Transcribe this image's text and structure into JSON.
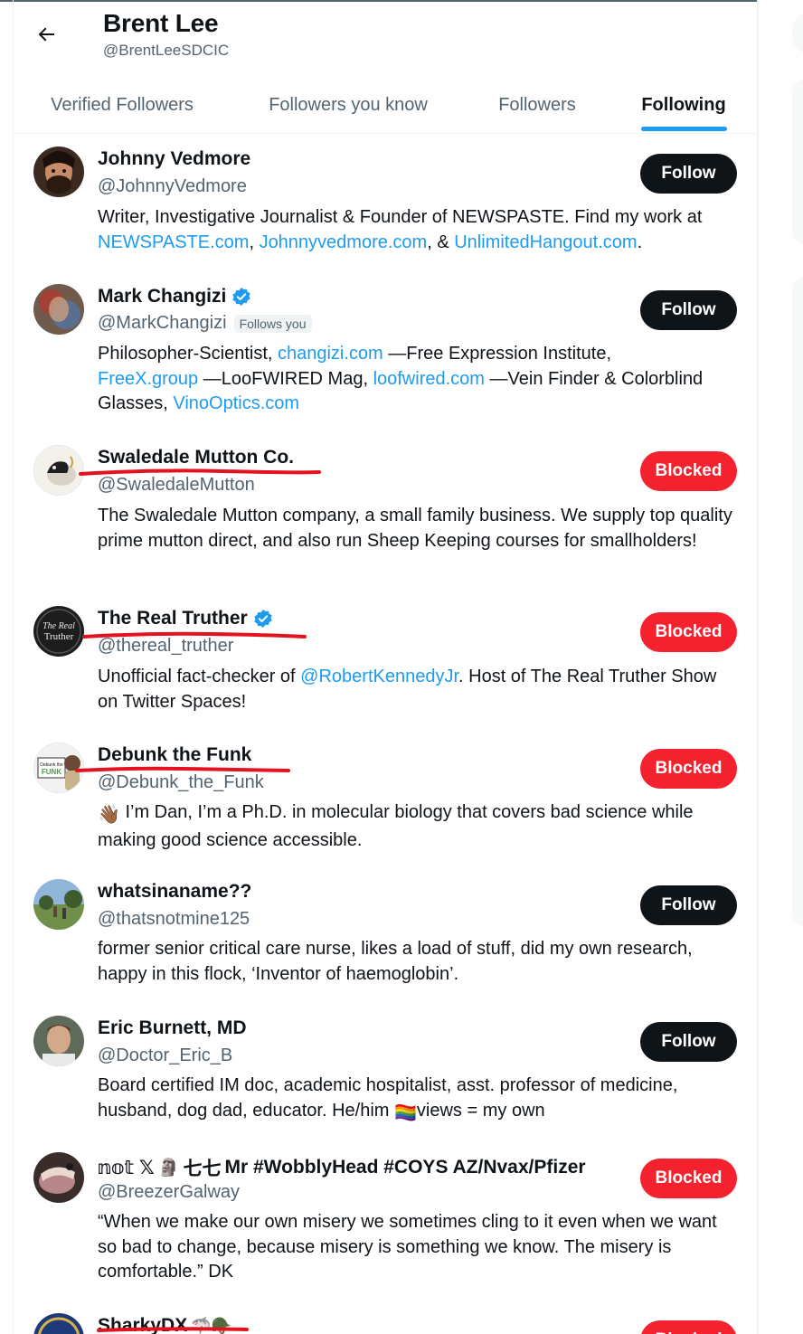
{
  "profile": {
    "name": "Brent Lee",
    "handle": "@BrentLeeSDCIC"
  },
  "tabs": [
    {
      "label": "Verified Followers"
    },
    {
      "label": "Followers you know"
    },
    {
      "label": "Followers"
    },
    {
      "label": "Following"
    }
  ],
  "active_tab": "Following",
  "accent_color": "#1d9bf0",
  "block_color": "#f4212e",
  "users": [
    {
      "name": "Johnny Vedmore",
      "handle": "@JohnnyVedmore",
      "button": "Follow",
      "bio_text": "Writer, Investigative Journalist & Founder of NEWSPASTE. Find my work at ",
      "bio_link1": "NEWSPASTE.com",
      "bio_sep1": ", ",
      "bio_link2": "Johnnyvedmore.com",
      "bio_sep2": ", & ",
      "bio_link3": "UnlimitedHangout.com",
      "bio_end": "."
    },
    {
      "name": "Mark Changizi",
      "handle": "@MarkChangizi",
      "follows_you": "Follows you",
      "button": "Follow",
      "bio_text": "Philosopher-Scientist, ",
      "bio_link1": "changizi.com",
      "bio_sep1": " —Free Expression Institute, ",
      "bio_link2": "FreeX.group",
      "bio_sep2": " —LooFWIRED Mag, ",
      "bio_link3": "loofwired.com",
      "bio_sep3": " —Vein Finder & Colorblind Glasses, ",
      "bio_link4": "VinoOptics.com"
    },
    {
      "name": "Swaledale Mutton Co.",
      "handle": "@SwaledaleMutton",
      "button": "Blocked",
      "bio_text": "The Swaledale Mutton company, a small family business. We supply top quality prime mutton direct, and also run Sheep Keeping courses for smallholders!"
    },
    {
      "name": "The Real Truther",
      "handle": "@thereal_truther",
      "button": "Blocked",
      "avatar_text1": "The Real",
      "avatar_text2": "Truther",
      "bio_text": "Unofficial fact-checker of ",
      "bio_link1": "@RobertKennedyJr",
      "bio_end": ". Host of The Real Truther Show on Twitter Spaces!"
    },
    {
      "name": "Debunk the Funk",
      "handle": "@Debunk_the_Funk",
      "button": "Blocked",
      "avatar_text1": "Debunk the",
      "avatar_text2": "FUNK",
      "bio_emoji": "👋🏾",
      "bio_text": " I’m Dan, I’m a Ph.D. in molecular biology that covers bad science while making good science accessible."
    },
    {
      "name": "whatsinaname??",
      "handle": "@thatsnotmine125",
      "button": "Follow",
      "bio_text": "former senior critical care nurse, likes a load of stuff, did my own research, happy in this flock, ‘Inventor of haemoglobin’."
    },
    {
      "name": "Eric Burnett, MD",
      "handle": "@Doctor_Eric_B",
      "button": "Follow",
      "bio_text": "Board certified IM doc, academic hospitalist, asst. professor of medicine, husband, dog dad, educator. He/him ",
      "bio_emoji": "🏳️‍🌈",
      "bio_end": "views = my own"
    },
    {
      "name_prefix": "𝕟𝕠𝕥 𝕏",
      "name_glyph": "🗿",
      "name_mid": " 七七 ",
      "name": "Mr #WobblyHead #COYS AZ/Nvax/Pfizer",
      "handle": "@BreezerGalway",
      "button": "Blocked",
      "bio_text": "“When we make our own misery we sometimes cling to it even when we want so bad to change, because misery is something we know. The misery is comfortable.” DK"
    },
    {
      "name": "SharkyDX",
      "name_icons": "🦈🪖",
      "button": "Blocked"
    }
  ]
}
